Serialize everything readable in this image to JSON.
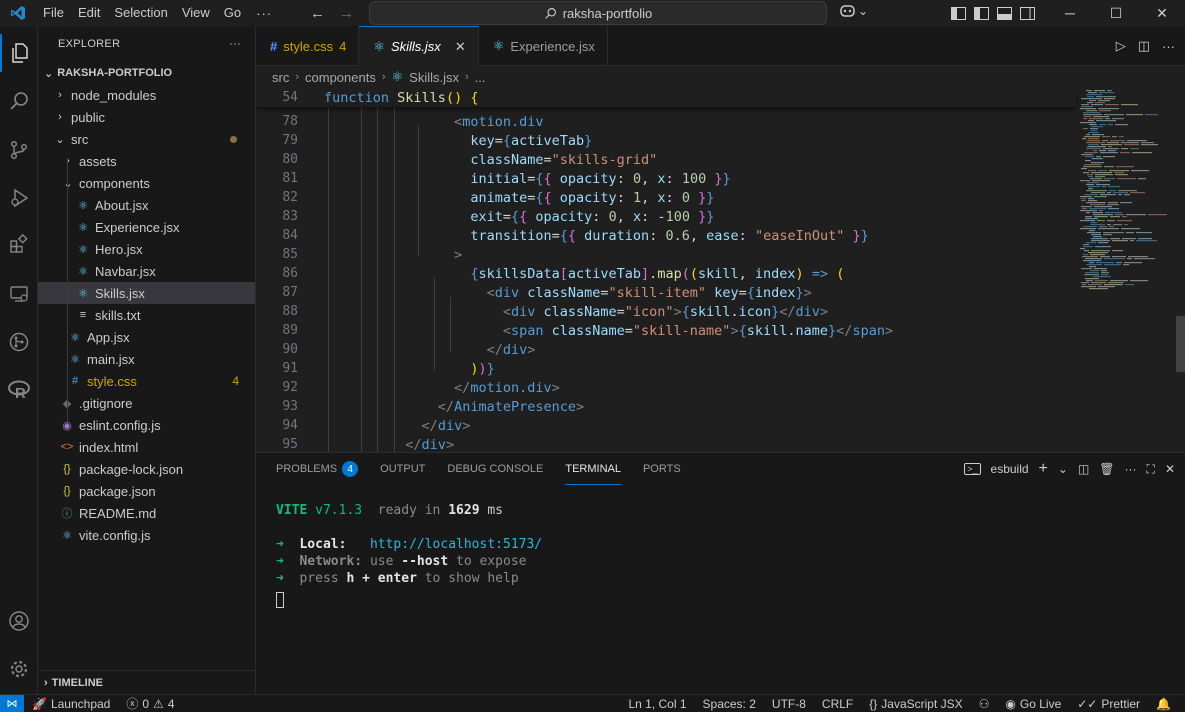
{
  "menu": [
    "File",
    "Edit",
    "Selection",
    "View",
    "Go"
  ],
  "menu_more": "···",
  "search": {
    "text": "raksha-portfolio"
  },
  "explorer": {
    "title": "EXPLORER",
    "more": "···",
    "root": "RAKSHA-PORTFOLIO",
    "items": [
      {
        "label": "node_modules",
        "type": "folder",
        "expanded": false
      },
      {
        "label": "public",
        "type": "folder",
        "expanded": false
      },
      {
        "label": "src",
        "type": "folder",
        "expanded": true
      },
      {
        "label": "assets",
        "type": "folder",
        "expanded": false
      },
      {
        "label": "components",
        "type": "folder",
        "expanded": true
      },
      {
        "label": "About.jsx",
        "type": "jsx"
      },
      {
        "label": "Experience.jsx",
        "type": "jsx"
      },
      {
        "label": "Hero.jsx",
        "type": "jsx"
      },
      {
        "label": "Navbar.jsx",
        "type": "jsx"
      },
      {
        "label": "Skills.jsx",
        "type": "jsx",
        "selected": true
      },
      {
        "label": "skills.txt",
        "type": "txt"
      },
      {
        "label": "App.jsx",
        "type": "jsx"
      },
      {
        "label": "main.jsx",
        "type": "jsx"
      },
      {
        "label": "style.css",
        "type": "css",
        "badge": "4"
      },
      {
        "label": ".gitignore",
        "type": "git"
      },
      {
        "label": "eslint.config.js",
        "type": "eslint"
      },
      {
        "label": "index.html",
        "type": "html"
      },
      {
        "label": "package-lock.json",
        "type": "json"
      },
      {
        "label": "package.json",
        "type": "json"
      },
      {
        "label": "README.md",
        "type": "info"
      },
      {
        "label": "vite.config.js",
        "type": "jsx"
      }
    ],
    "timeline": "TIMELINE"
  },
  "tabs": [
    {
      "label": "style.css",
      "badge": "4",
      "icon": "css"
    },
    {
      "label": "Skills.jsx",
      "active": true,
      "icon": "react"
    },
    {
      "label": "Experience.jsx",
      "icon": "react"
    }
  ],
  "breadcrumb": [
    "src",
    "components",
    "Skills.jsx",
    "..."
  ],
  "code": {
    "sticky": {
      "num": "54",
      "text": "function Skills() {"
    },
    "lines": [
      {
        "num": "78"
      },
      {
        "num": "79"
      },
      {
        "num": "80"
      },
      {
        "num": "81"
      },
      {
        "num": "82"
      },
      {
        "num": "83"
      },
      {
        "num": "84"
      },
      {
        "num": "85"
      },
      {
        "num": "86"
      },
      {
        "num": "87"
      },
      {
        "num": "88"
      },
      {
        "num": "89"
      },
      {
        "num": "90"
      },
      {
        "num": "91"
      },
      {
        "num": "92"
      },
      {
        "num": "93"
      },
      {
        "num": "94"
      },
      {
        "num": "95"
      }
    ]
  },
  "panel": {
    "tabs": [
      "PROBLEMS",
      "OUTPUT",
      "DEBUG CONSOLE",
      "TERMINAL",
      "PORTS"
    ],
    "problems_count": "4",
    "terminal_name": "esbuild",
    "vite": {
      "name": "VITE",
      "version": "v7.1.3",
      "ready": "ready in",
      "ms": "1629",
      "unit": "ms"
    },
    "local_label": "Local:",
    "local_url": "http://localhost:5173/",
    "network_label": "Network:",
    "network_text": "use",
    "network_flag": "--host",
    "network_tail": "to expose",
    "help_pre": "press",
    "help_key": "h + enter",
    "help_tail": "to show help"
  },
  "status": {
    "launchpad": "Launchpad",
    "errors": "0",
    "warnings": "4",
    "position": "Ln 1, Col 1",
    "spaces": "Spaces: 2",
    "encoding": "UTF-8",
    "eol": "CRLF",
    "language": "JavaScript JSX",
    "golive": "Go Live",
    "prettier": "Prettier"
  },
  "colors": {
    "accent": "#0078d4",
    "warning": "#cca700"
  }
}
